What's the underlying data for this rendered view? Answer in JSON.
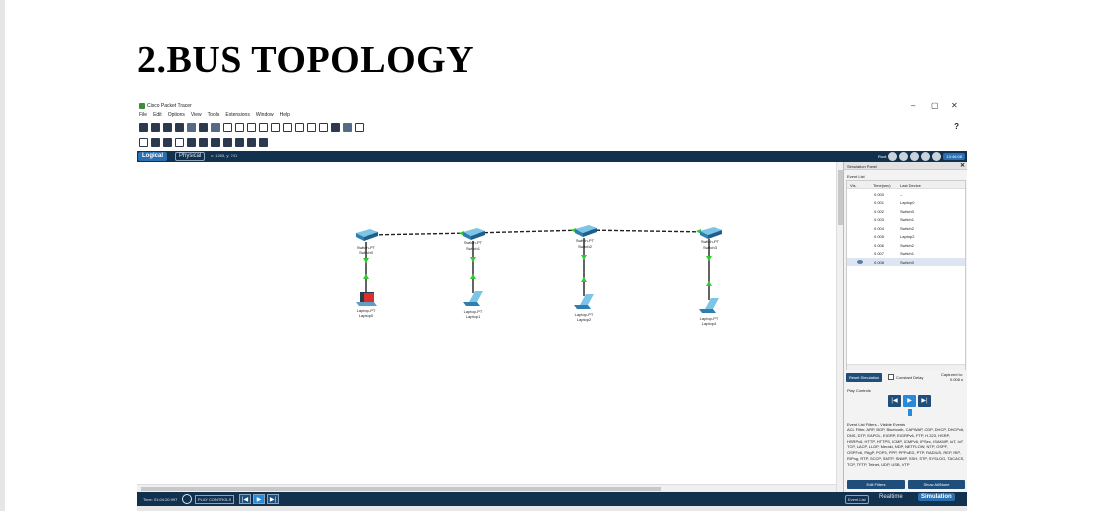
{
  "heading": "2.BUS TOPOLOGY",
  "app": {
    "title": "Cisco Packet Tracer",
    "window_controls": [
      "–",
      "▢",
      "✕"
    ],
    "help": "?"
  },
  "menu": [
    "File",
    "Edit",
    "Options",
    "View",
    "Tools",
    "Extensions",
    "Window",
    "Help"
  ],
  "nav": {
    "logical": "Logical",
    "physical": "Physical",
    "coord": "x: 1265, y: 741",
    "root": "Root",
    "clock": "13:46:08"
  },
  "devices": {
    "switches": [
      {
        "model": "Switch-PT",
        "name": "Switch0"
      },
      {
        "model": "Switch-PT",
        "name": "Switch1"
      },
      {
        "model": "Switch-PT",
        "name": "Switch2"
      },
      {
        "model": "Switch-PT",
        "name": "Switch3"
      }
    ],
    "laptops": [
      {
        "model": "Laptop-PT",
        "name": "Laptop0"
      },
      {
        "model": "Laptop-PT",
        "name": "Laptop1"
      },
      {
        "model": "Laptop-PT",
        "name": "Laptop2"
      },
      {
        "model": "Laptop-PT",
        "name": "Laptop4"
      }
    ]
  },
  "sim": {
    "panel_title": "Simulation Panel",
    "event_list_title": "Event List",
    "columns": [
      "Vis.",
      "Time(sec)",
      "Last Device"
    ],
    "events": [
      {
        "time": "0.000",
        "device": "--"
      },
      {
        "time": "0.001",
        "device": "Laptop0"
      },
      {
        "time": "0.002",
        "device": "Switch0"
      },
      {
        "time": "0.003",
        "device": "Switch1"
      },
      {
        "time": "0.004",
        "device": "Switch2"
      },
      {
        "time": "0.005",
        "device": "Laptop2"
      },
      {
        "time": "0.006",
        "device": "Switch2"
      },
      {
        "time": "0.007",
        "device": "Switch1"
      },
      {
        "time": "0.008",
        "device": "Switch0"
      }
    ],
    "reset": "Reset Simulation",
    "constant_delay": "Constant Delay",
    "captured_label": "Captured to:",
    "captured_value": "0.008 s",
    "play_controls": "Play Controls",
    "filters_title": "Event List Filters - Visible Events",
    "filters_text": "ACL Filter, ARP, BGP, Bluetooth, CAPWAP, CDP, DHCP, DHCPv6, DNS, DTP, EAPOL, EIGRP, EIGRPv6, FTP, H.323, HSRP, HSRPv6, HTTP, HTTPS, ICMP, ICMPv6, IPSec, ISAKMP, IoT, IoT TCP, LACP, LLDP, Meraki, NDP, NETFLOW, NTP, OSPF, OSPFv6, PAgP, POP3, PPP, PPPoED, PTP, RADIUS, REP, RIP, RIPng, RTP, SCCP, SMTP, SNMP, SSH, STP, SYSLOG, TACACS, TCP, TFTP, Telnet, UDP, USB, VTP",
    "edit_filters": "Edit Filters",
    "show_all": "Show All/None"
  },
  "status": {
    "time": "Time: 01:04:20.997",
    "play_controls": "PLAY CONTROLS",
    "event_list": "Event List",
    "realtime": "Realtime",
    "simulation": "Simulation"
  }
}
